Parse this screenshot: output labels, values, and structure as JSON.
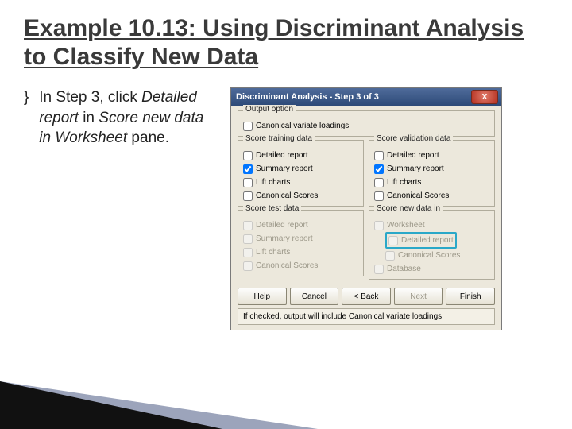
{
  "slide": {
    "title": "Example 10.13: Using Discriminant Analysis to Classify New Data",
    "bullet_line1": "In Step 3, click ",
    "bullet_line2": "Detailed report",
    "bullet_line3": " in ",
    "bullet_line4": "Score new data in Worksheet",
    "bullet_line5": " pane."
  },
  "dialog": {
    "title": "Discriminant Analysis - Step 3 of 3",
    "group_output": {
      "label": "Output option",
      "item": "Canonical variate loadings"
    },
    "group_train": {
      "label": "Score training data",
      "detailed": "Detailed report",
      "summary": "Summary report",
      "lift": "Lift charts",
      "canon": "Canonical Scores"
    },
    "group_valid": {
      "label": "Score validation data",
      "detailed": "Detailed report",
      "summary": "Summary report",
      "lift": "Lift charts",
      "canon": "Canonical Scores"
    },
    "group_test": {
      "label": "Score test data",
      "detailed": "Detailed report",
      "summary": "Summary report",
      "lift": "Lift charts",
      "canon": "Canonical Scores"
    },
    "group_newws": {
      "label": "Score new data in",
      "worksheet": "Worksheet",
      "detailed": "Detailed report",
      "canonical": "Canonical Scores",
      "database": "Database"
    },
    "buttons": {
      "help": "Help",
      "cancel": "Cancel",
      "back": "< Back",
      "next": "Next",
      "finish": "Finish"
    },
    "status": "If checked, output will include Canonical variate loadings."
  }
}
